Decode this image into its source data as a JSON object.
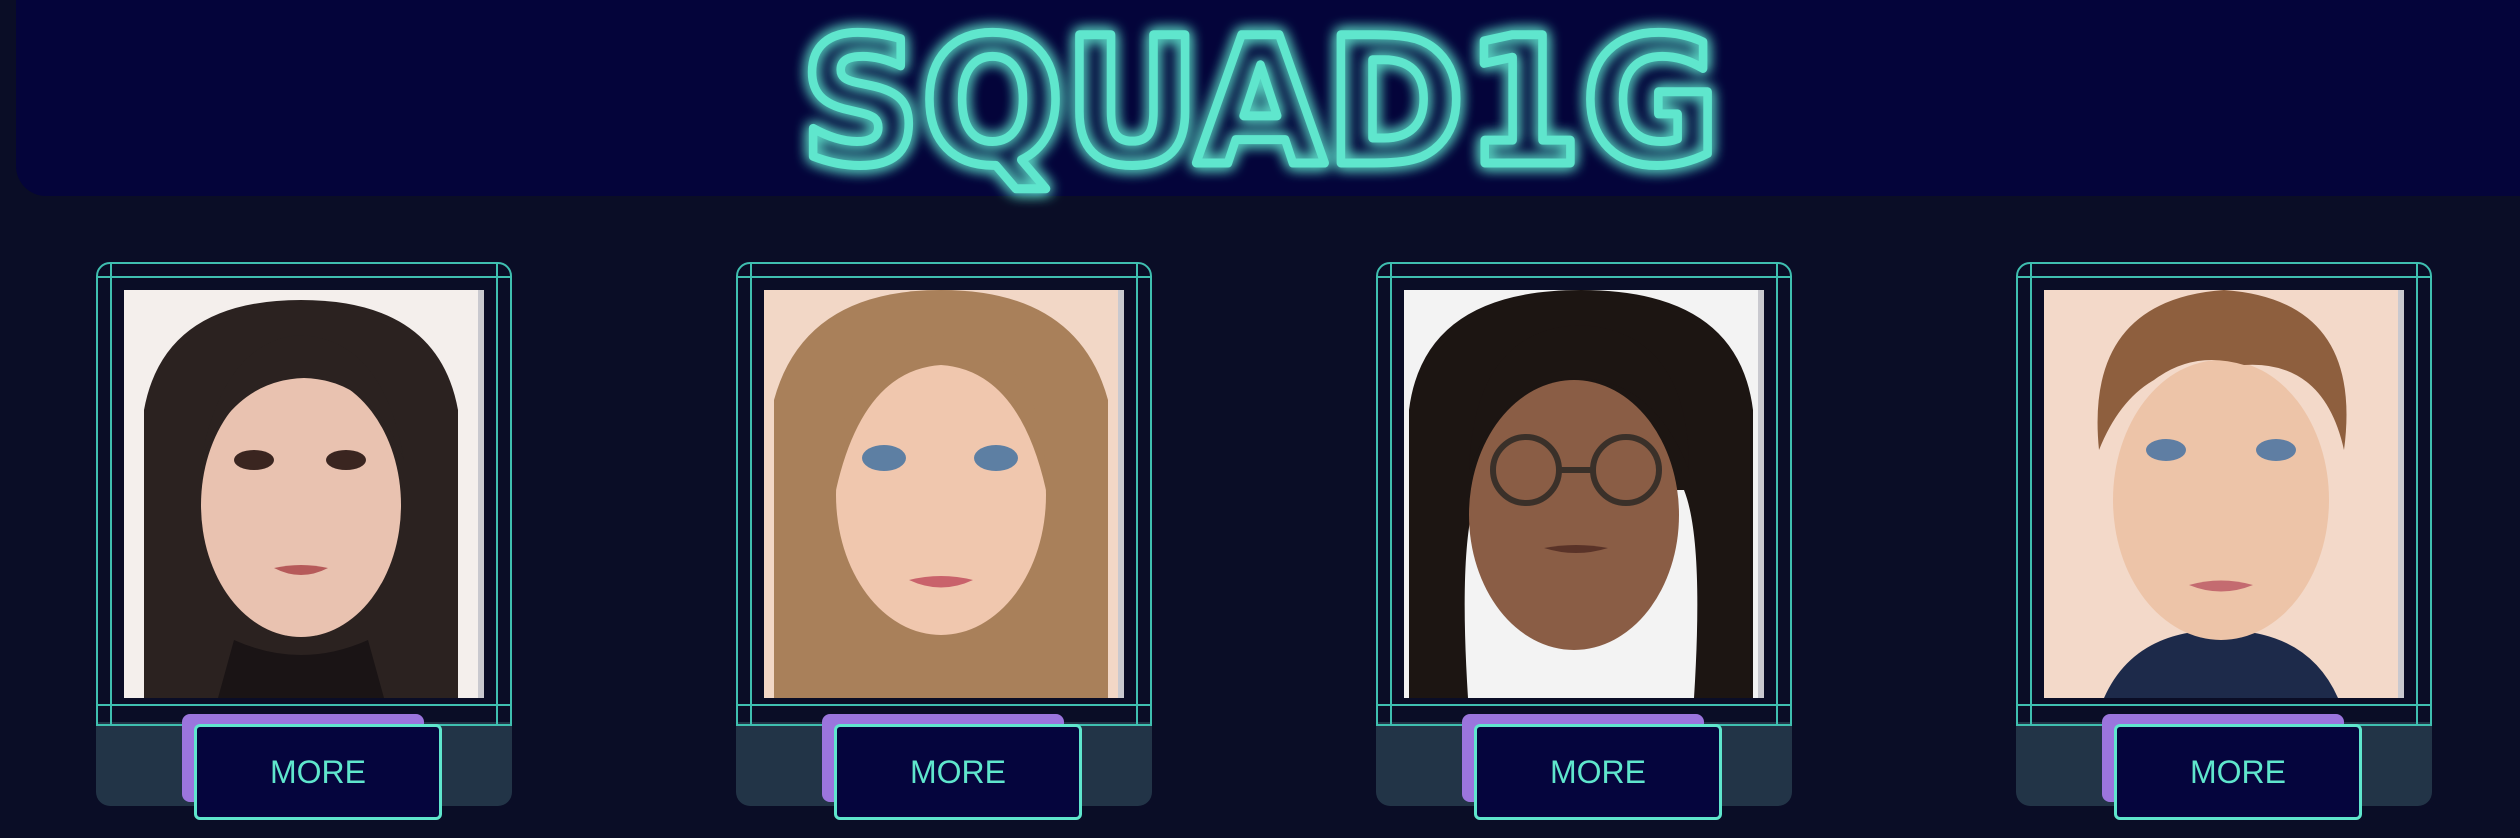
{
  "header": {
    "logo_text": "SQUAD1G"
  },
  "colors": {
    "accent": "#5fe6cd",
    "button_shadow": "#9b75dd",
    "background": "#0a0d26",
    "header_band": "#04043a"
  },
  "cards": [
    {
      "portrait": "woman-dark-hair-portrait",
      "button_label": "MORE"
    },
    {
      "portrait": "woman-blonde-hair-portrait",
      "button_label": "MORE"
    },
    {
      "portrait": "woman-curly-hair-glasses-portrait",
      "button_label": "MORE"
    },
    {
      "portrait": "man-brown-hair-portrait",
      "button_label": "MORE"
    }
  ]
}
